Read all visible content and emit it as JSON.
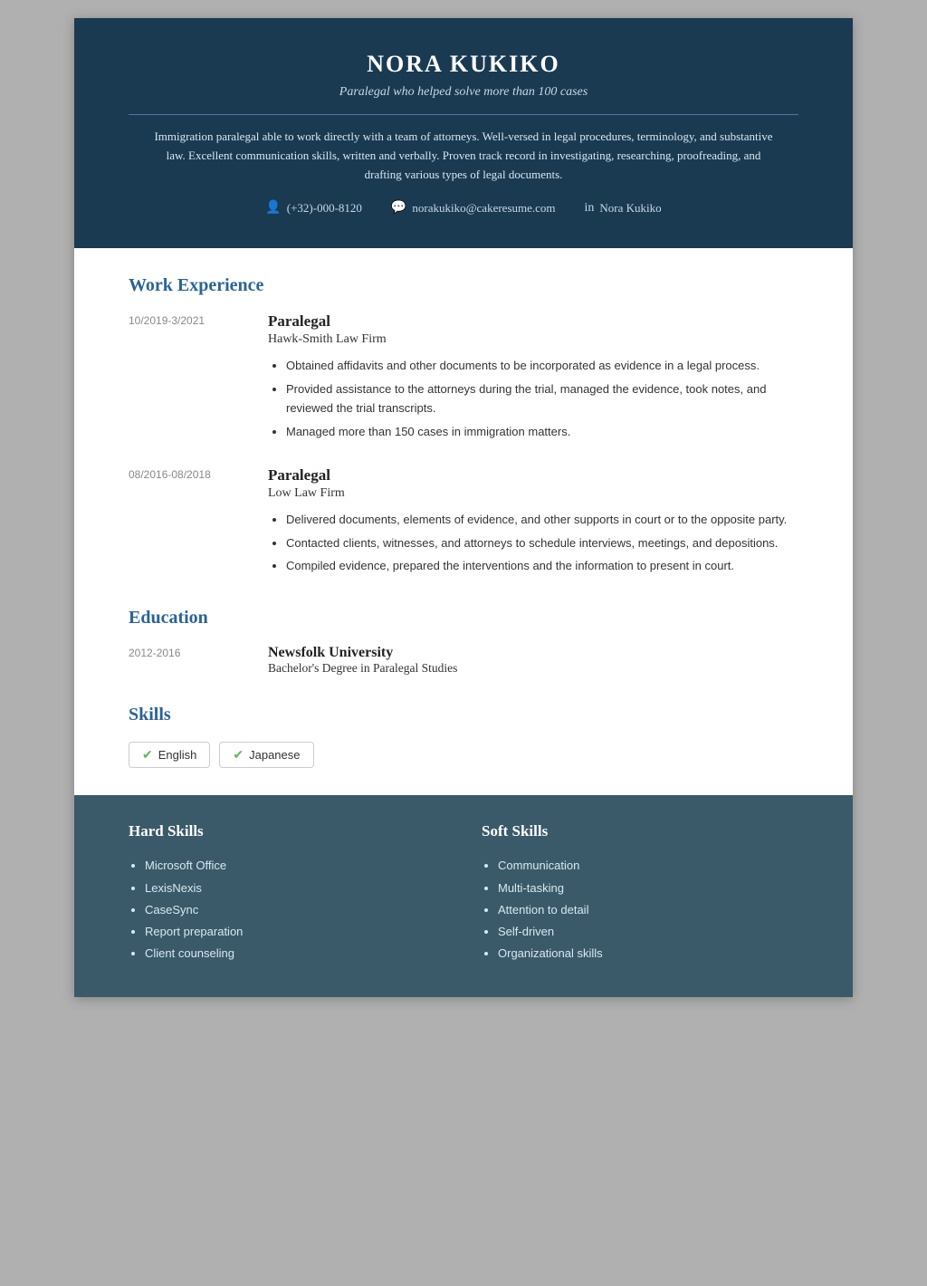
{
  "header": {
    "name": "NORA KUKIKO",
    "subtitle": "Paralegal who helped solve more than 100 cases",
    "summary": "Immigration paralegal able to work directly with a team of attorneys. Well-versed in legal procedures, terminology, and substantive law. Excellent communication skills, written and verbally. Proven track record in investigating, researching, proofreading, and drafting various types of legal documents.",
    "contact": {
      "phone": "(+32)-000-8120",
      "email": "norakukiko@cakeresume.com",
      "linkedin": "Nora Kukiko"
    }
  },
  "work_experience": {
    "section_title": "Work Experience",
    "jobs": [
      {
        "date": "10/2019-3/2021",
        "title": "Paralegal",
        "company": "Hawk-Smith Law Firm",
        "bullets": [
          "Obtained affidavits and other documents to be incorporated as evidence in a legal process.",
          "Provided assistance to the attorneys during the trial, managed the evidence, took notes, and reviewed the trial transcripts.",
          "Managed more than 150 cases in immigration matters."
        ]
      },
      {
        "date": "08/2016-08/2018",
        "title": "Paralegal",
        "company": "Low Law Firm",
        "bullets": [
          "Delivered documents, elements of evidence, and other supports in court or to the opposite party.",
          "Contacted clients, witnesses, and attorneys to schedule interviews, meetings, and depositions.",
          "Compiled evidence, prepared the interventions and the information to present in court."
        ]
      }
    ]
  },
  "education": {
    "section_title": "Education",
    "items": [
      {
        "date": "2012-2016",
        "school": "Newsfolk University",
        "degree": "Bachelor's Degree in Paralegal Studies"
      }
    ]
  },
  "skills": {
    "section_title": "Skills",
    "tags": [
      "English",
      "Japanese"
    ]
  },
  "hard_skills": {
    "section_title": "Hard Skills",
    "items": [
      "Microsoft Office",
      "LexisNexis",
      "CaseSync",
      "Report preparation",
      "Client counseling"
    ]
  },
  "soft_skills": {
    "section_title": "Soft Skills",
    "items": [
      "Communication",
      "Multi-tasking",
      "Attention to detail",
      "Self-driven",
      "Organizational skills"
    ]
  }
}
